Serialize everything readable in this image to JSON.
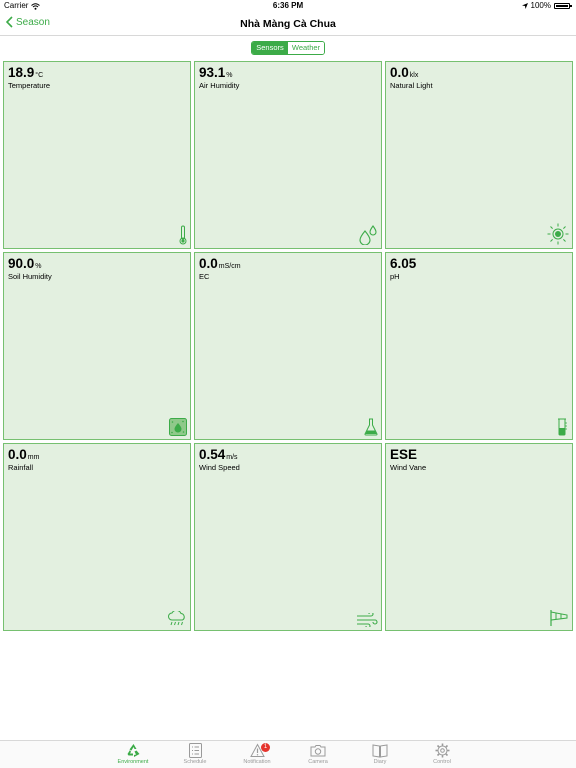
{
  "status_bar": {
    "carrier": "Carrier",
    "time": "6:36 PM",
    "battery": "100%"
  },
  "nav": {
    "back_label": "Season",
    "title": "Nhà Màng Cà Chua"
  },
  "segments": [
    {
      "label": "Sensors",
      "active": true
    },
    {
      "label": "Weather",
      "active": false
    }
  ],
  "sensors": [
    {
      "value": "18.9",
      "unit": "°C",
      "label": "Temperature",
      "icon": "thermometer-icon"
    },
    {
      "value": "93.1",
      "unit": "%",
      "label": "Air Humidity",
      "icon": "water-drops-icon"
    },
    {
      "value": "0.0",
      "unit": "klx",
      "label": "Natural Light",
      "icon": "sun-icon"
    },
    {
      "value": "90.0",
      "unit": "%",
      "label": "Soil Humidity",
      "icon": "soil-moisture-icon"
    },
    {
      "value": "0.0",
      "unit": "mS/cm",
      "label": "EC",
      "icon": "flask-icon"
    },
    {
      "value": "6.05",
      "unit": "",
      "label": "pH",
      "icon": "beaker-icon"
    },
    {
      "value": "0.0",
      "unit": "mm",
      "label": "Rainfall",
      "icon": "rain-cloud-icon"
    },
    {
      "value": "0.54",
      "unit": "m/s",
      "label": "Wind Speed",
      "icon": "wind-icon"
    },
    {
      "value": "ESE",
      "unit": "",
      "label": "Wind Vane",
      "icon": "windsock-icon"
    }
  ],
  "tabs": [
    {
      "label": "Environment",
      "active": true
    },
    {
      "label": "Schedule",
      "active": false
    },
    {
      "label": "Notification",
      "active": false,
      "badge": "1"
    },
    {
      "label": "Camera",
      "active": false
    },
    {
      "label": "Diary",
      "active": false
    },
    {
      "label": "Control",
      "active": false
    }
  ],
  "colors": {
    "accent": "#3cab48",
    "card_bg": "#e3f0e0",
    "card_border": "#76c070",
    "badge": "#e5342d"
  }
}
